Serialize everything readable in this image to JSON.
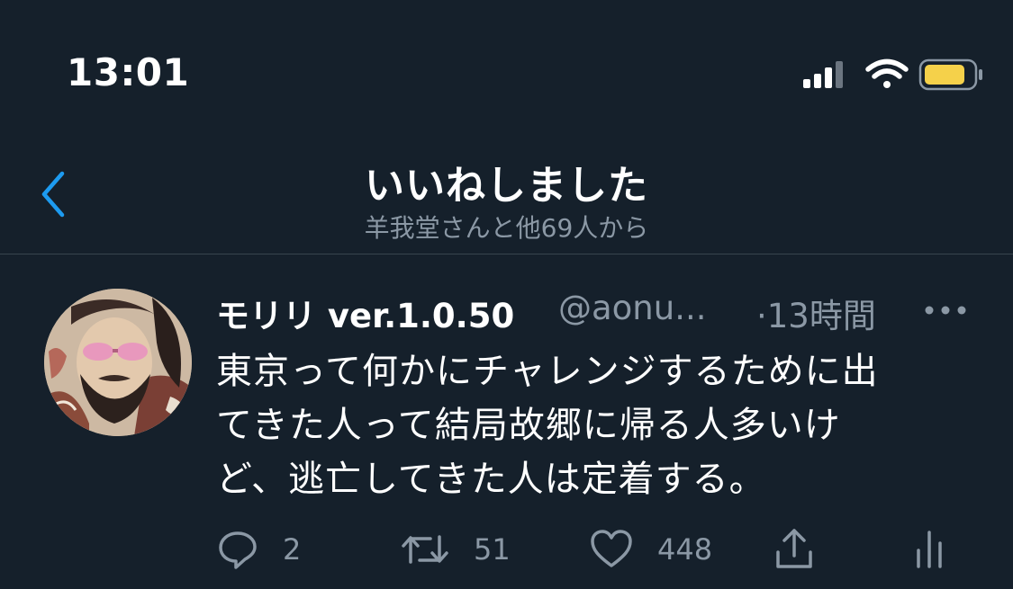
{
  "status_bar": {
    "time": "13:01",
    "icons": [
      "cellular-signal-icon",
      "wifi-icon",
      "battery-icon"
    ],
    "battery_color": "#f5d14a"
  },
  "header": {
    "title": "いいねしました",
    "subtitle": "羊我堂さんと他69人から",
    "back_icon": "chevron-left-icon",
    "accent_color": "#1d9bf0"
  },
  "tweet": {
    "display_name": "モリリ ver.1.0.50",
    "handle": "@aonu...",
    "timestamp": "·13時間",
    "more_icon": "more-horizontal-icon",
    "text_lines": [
      "東京って何かにチャレンジするために出",
      "てきた人って結局故郷に帰る人多いけ",
      "ど、逃亡してきた人は定着する。"
    ],
    "actions": {
      "reply_count": "2",
      "retweet_count": "51",
      "like_count": "448"
    }
  },
  "colors": {
    "background": "#15202b",
    "secondary_text": "#8b98a5",
    "divider": "#38444d"
  }
}
